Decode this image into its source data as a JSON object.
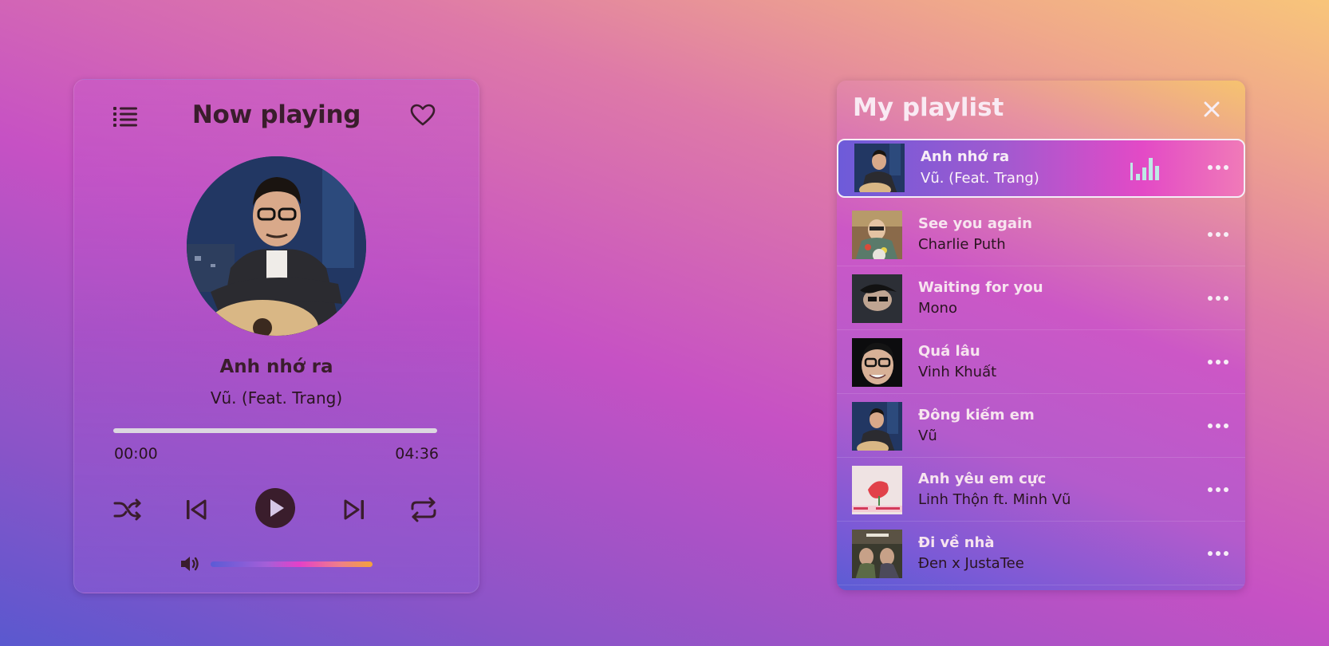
{
  "player": {
    "header_title": "Now playing",
    "song_title": "Anh nhớ ra",
    "song_artist": "Vũ. (Feat. Trang)",
    "time_current": "00:00",
    "time_total": "04:36",
    "progress_fraction": 0,
    "volume_fraction": 1.0,
    "icons": [
      "list-icon",
      "heart-icon",
      "shuffle-icon",
      "previous-icon",
      "play-icon",
      "next-icon",
      "repeat-icon",
      "volume-icon"
    ]
  },
  "playlist": {
    "title": "My playlist",
    "close_icon": "close-icon",
    "items": [
      {
        "title": "Anh nhớ ra",
        "artist": "Vũ. (Feat. Trang)",
        "active": true
      },
      {
        "title": "See you again",
        "artist": "Charlie Puth"
      },
      {
        "title": "Waiting for you",
        "artist": "Mono"
      },
      {
        "title": "Quá lâu",
        "artist": "Vinh Khuất"
      },
      {
        "title": "Đông kiếm em",
        "artist": "Vũ"
      },
      {
        "title": "Anh yêu em cực",
        "artist": "Linh Thộn ft. Minh Vũ"
      },
      {
        "title": "Đi về nhà",
        "artist": "Đen x JustaTee"
      }
    ]
  },
  "colors": {
    "text_dark": "#3a1d2c",
    "text_light": "#f7e4ef",
    "accent_volume_start": "#5b5bd6",
    "accent_volume_end": "#f4a23a"
  }
}
